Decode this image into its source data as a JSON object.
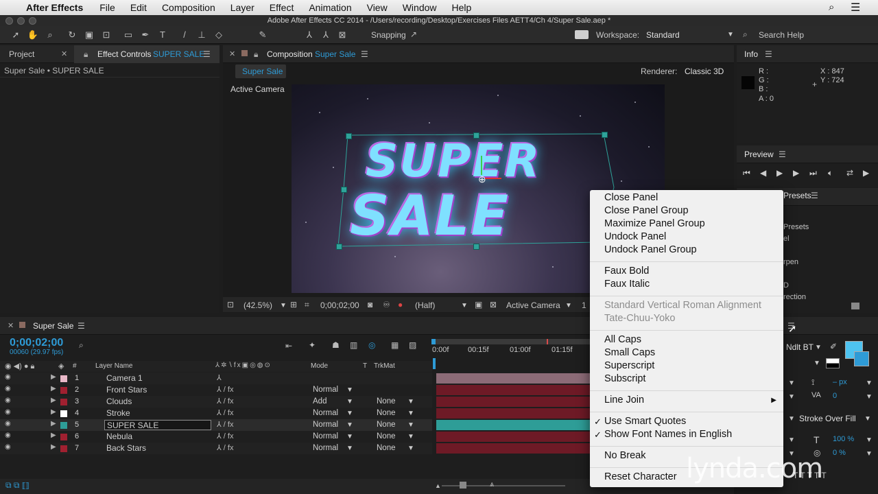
{
  "menubar": {
    "app": "After Effects",
    "items": [
      "File",
      "Edit",
      "Composition",
      "Layer",
      "Effect",
      "Animation",
      "View",
      "Window",
      "Help"
    ]
  },
  "window_title": "Adobe After Effects CC 2014 - /Users/recording/Desktop/Exercises Files AETT4/Ch 4/Super Sale.aep *",
  "toolbar": {
    "snapping": "Snapping",
    "workspace_label": "Workspace:",
    "workspace_value": "Standard",
    "search_help": "Search Help"
  },
  "project_panel": {
    "tab_project": "Project",
    "tab_effect_controls": "Effect Controls",
    "effect_target": "SUPER SALE",
    "breadcrumb": "Super Sale • SUPER SALE"
  },
  "composition_panel": {
    "tab_label": "Composition",
    "tab_name": "Super Sale",
    "comp_button": "Super Sale",
    "renderer_label": "Renderer:",
    "renderer_value": "Classic 3D",
    "view_label": "Active Camera",
    "art_line1": "SUPER",
    "art_line2": "SALE",
    "footer": {
      "zoom": "(42.5%)",
      "timecode": "0;00;02;00",
      "resolution": "(Half)",
      "camera": "Active Camera",
      "views": "1"
    }
  },
  "info_panel": {
    "title": "Info",
    "r": "R :",
    "g": "G :",
    "b": "B :",
    "a": "A : 0",
    "x": "X : 847",
    "y": "Y : 724"
  },
  "preview_panel": {
    "title": "Preview"
  },
  "effects_panel": {
    "title_fragment": "Presets",
    "items": [
      "Presets",
      "el",
      "rpen",
      "D",
      "rection"
    ]
  },
  "character_panel": {
    "font": "Ndlt BT",
    "px": "– px",
    "zero": "0",
    "stroke_mode": "Stroke Over Fill",
    "scale_v": "100 %",
    "baseline": "0 %"
  },
  "timeline": {
    "tab_name": "Super Sale",
    "timecode": "0;00;02;00",
    "frames": "00060 (29.97 fps)",
    "col_layer_name": "Layer Name",
    "col_mode": "Mode",
    "col_t": "T",
    "col_trkmat": "TrkMat",
    "ruler": [
      "0:00f",
      "00:15f",
      "01:00f",
      "01:15f"
    ],
    "layers": [
      {
        "num": "1",
        "name": "Camera 1",
        "mode": "",
        "trkmat": "",
        "color": "#e8b8c8"
      },
      {
        "num": "2",
        "name": "Front Stars",
        "mode": "Normal",
        "trkmat": "",
        "color": "#a02030"
      },
      {
        "num": "3",
        "name": "Clouds",
        "mode": "Add",
        "trkmat": "None",
        "color": "#a02030"
      },
      {
        "num": "4",
        "name": "Stroke",
        "mode": "Normal",
        "trkmat": "None",
        "color": "#ffffff"
      },
      {
        "num": "5",
        "name": "SUPER SALE",
        "mode": "Normal",
        "trkmat": "None",
        "color": "#2e9d97"
      },
      {
        "num": "6",
        "name": "Nebula",
        "mode": "Normal",
        "trkmat": "None",
        "color": "#a02030"
      },
      {
        "num": "7",
        "name": "Back Stars",
        "mode": "Normal",
        "trkmat": "None",
        "color": "#a02030"
      }
    ]
  },
  "context_menu": {
    "groups": [
      [
        "Close Panel",
        "Close Panel Group",
        "Maximize Panel Group",
        "Undock Panel",
        "Undock Panel Group"
      ],
      [
        "Faux Bold",
        "Faux Italic"
      ],
      [
        "Standard Vertical Roman Alignment",
        "Tate-Chuu-Yoko"
      ],
      [
        "All Caps",
        "Small Caps",
        "Superscript",
        "Subscript"
      ],
      [
        "Line Join"
      ],
      [
        "Use Smart Quotes",
        "Show Font Names in English"
      ],
      [
        "No Break"
      ],
      [
        "Reset Character"
      ]
    ],
    "disabled": [
      "Standard Vertical Roman Alignment",
      "Tate-Chuu-Yoko"
    ],
    "checked": [
      "Use Smart Quotes",
      "Show Font Names in English"
    ],
    "submenu": [
      "Line Join"
    ]
  },
  "watermark": "lynda.com",
  "colors": {
    "accent": "#2e9bd6",
    "layer_red": "#6e1a26",
    "layer_teal": "#2e9d97",
    "camera_bar": "#8c6b77"
  }
}
